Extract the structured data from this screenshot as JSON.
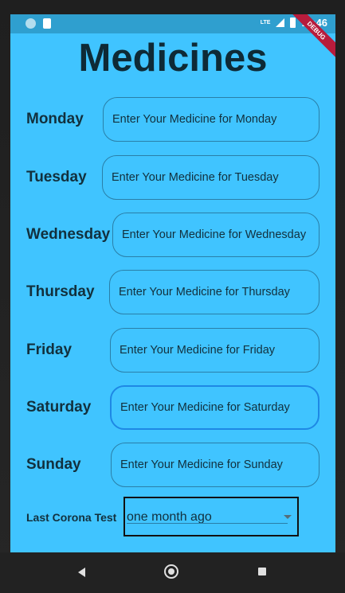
{
  "status_bar": {
    "time": "11:46",
    "network": "LTE",
    "debug_banner": "DEBUG"
  },
  "title": "Medicines",
  "days": [
    {
      "label": "Monday",
      "placeholder": "Enter Your Medicine for Monday"
    },
    {
      "label": "Tuesday",
      "placeholder": "Enter Your Medicine for Tuesday"
    },
    {
      "label": "Wednesday",
      "placeholder": "Enter Your Medicine for Wednesday"
    },
    {
      "label": "Thursday",
      "placeholder": "Enter Your Medicine for Thursday"
    },
    {
      "label": "Friday",
      "placeholder": "Enter Your Medicine for Friday"
    },
    {
      "label": "Saturday",
      "placeholder": "Enter Your Medicine for Saturday"
    },
    {
      "label": "Sunday",
      "placeholder": "Enter Your Medicine for Sunday"
    }
  ],
  "corona_test": {
    "label": "Last Corona Test",
    "selected": "one month ago"
  },
  "colors": {
    "background": "#40c4ff",
    "status_bar": "#2f9fcf",
    "text": "#12303d",
    "focused_border": "#1e88e5",
    "debug_ribbon": "#b71c3c"
  },
  "icons": {
    "nav_back": "back-icon",
    "nav_home": "home-icon",
    "nav_recents": "recents-icon"
  }
}
